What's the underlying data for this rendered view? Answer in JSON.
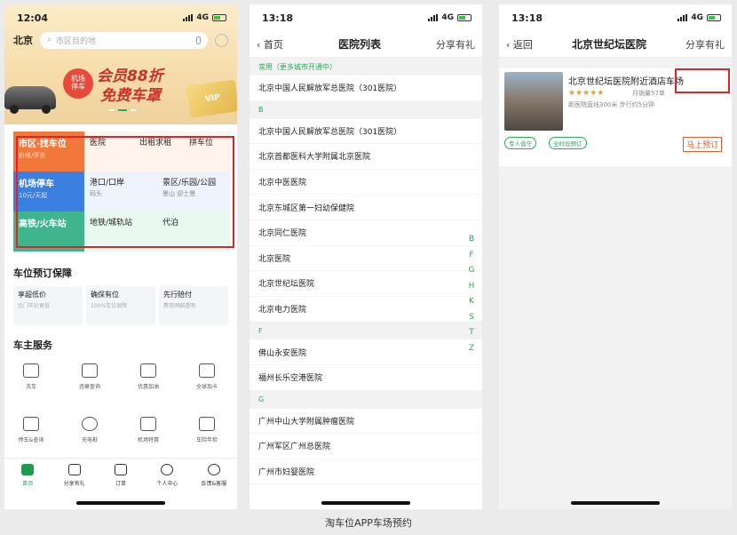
{
  "caption": "淘车位APP车场预约",
  "colors": {
    "brand_green": "#1e9b4f",
    "highlight_red": "#d9252b",
    "accent_orange": "#f2773a"
  },
  "screen1": {
    "status": {
      "time": "12:04",
      "network": "4G"
    },
    "city": "北京",
    "search_placeholder": "市区目的地",
    "banner": {
      "badge_line1": "机场",
      "badge_line2": "停车",
      "title1": "会员88折",
      "title2": "免费车罩",
      "card": "VIP"
    },
    "grid": {
      "city_park": {
        "title": "市区·找车位",
        "sub": "价格/评论"
      },
      "hospital": "医院",
      "taxi": "出租求租",
      "carpool": "拼车位",
      "airport": {
        "title": "机场停车",
        "sub": "10元/天起"
      },
      "port": {
        "title": "港口/口岸",
        "sub": "码头"
      },
      "scenic": {
        "title": "景区/乐园/公园",
        "sub": "景山  迎士景"
      },
      "rail": {
        "title": "高铁/火车站"
      },
      "metro": "地铁/城轨站",
      "valet": "代泊"
    },
    "guarantee": {
      "title": "车位预订保障",
      "items": [
        {
          "title": "享超低价",
          "sub": "比门市价更低"
        },
        {
          "title": "确保有位",
          "sub": "100%车位保障"
        },
        {
          "title": "先行赔付",
          "sub": "费用明细透明"
        }
      ]
    },
    "services": {
      "title": "车主服务",
      "items": [
        "洗车",
        "违章查询",
        "优惠加油",
        "全球加卡",
        "停车&查询",
        "充电桩",
        "机场特惠",
        "车险年检"
      ]
    },
    "tabs": [
      "首页",
      "分享有礼",
      "订单",
      "个人中心",
      "反馈&客服"
    ]
  },
  "screen2": {
    "status": {
      "time": "13:18",
      "network": "4G"
    },
    "back": "首页",
    "title": "医院列表",
    "share": "分享有礼",
    "groups": [
      {
        "header": "常用（更多城市开通中）",
        "items": [
          "北京中国人民解放军总医院（301医院）"
        ]
      },
      {
        "header": "B",
        "items": [
          "北京中国人民解放军总医院（301医院）",
          "北京首都医科大学附属北京医院",
          "北京中医医院",
          "北京东城区第一妇幼保健院",
          "北京同仁医院",
          "北京医院",
          "北京世纪坛医院",
          "北京电力医院"
        ]
      },
      {
        "header": "F",
        "items": [
          "佛山永安医院",
          "福州长乐空港医院"
        ]
      },
      {
        "header": "G",
        "items": [
          "广州中山大学附属肿瘤医院",
          "广州军区广州总医院",
          "广州市妇婴医院"
        ]
      }
    ],
    "index": [
      "B",
      "F",
      "G",
      "H",
      "K",
      "S",
      "T",
      "Z"
    ]
  },
  "screen3": {
    "status": {
      "time": "13:18",
      "network": "4G"
    },
    "back": "返回",
    "title": "北京世纪坛医院",
    "share": "分享有礼",
    "card": {
      "title": "北京世纪坛医院附近酒店车场",
      "stars": "★★★★★",
      "sales": "月销量57单",
      "distance": "距医院直线300米 步行约5分钟",
      "tags": [
        "专人值守",
        "全时段预订"
      ],
      "book": "马上预订"
    }
  }
}
